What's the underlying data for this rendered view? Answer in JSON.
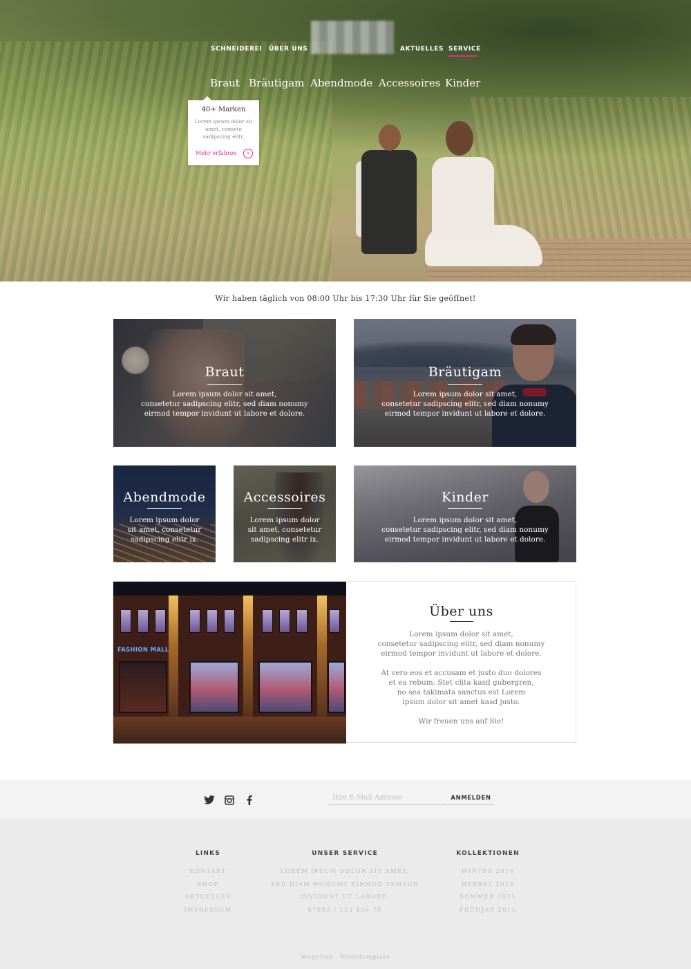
{
  "nav": {
    "items": [
      "SCHNEIDEREI",
      "ÜBER UNS",
      "AKTUELLES",
      "SERVICE"
    ],
    "active": "SERVICE",
    "accent_color": "#d9317f"
  },
  "subnav": {
    "items": [
      "Braut",
      "Bräutigam",
      "Abendmode",
      "Accessoires",
      "Kinder"
    ]
  },
  "dropdown": {
    "title": "40+ Marken",
    "text": "Lorem ipsum dolor sit amet, consete sadipscing elitr.",
    "link": "Mehr erfahren",
    "link_icon": "chevron-right-circle-icon"
  },
  "hours": "Wir haben täglich von 08:00 Uhr bis 17:30 Uhr für Sie geöffnet!",
  "tiles": [
    {
      "title": "Braut",
      "text": [
        "Lorem ipsum dolor sit amet,",
        "consetetur sadipscing elitr, sed diam nonumy",
        "eirmod tempor invidunt ut labore et dolore."
      ]
    },
    {
      "title": "Bräutigam",
      "text": [
        "Lorem ipsum dolor sit amet,",
        "consetetur sadipscing elitr, sed diam nonumy",
        "eirmod tempor invidunt ut labore et dolore."
      ]
    },
    {
      "title": "Abendmode",
      "text": [
        "Lorem ipsum dolor",
        "sit amet, consetetur",
        "sadipscing elitr ix."
      ]
    },
    {
      "title": "Accessoires",
      "text": [
        "Lorem ipsum dolor",
        "sit amet, consetetur",
        "sadipscing elitr ix."
      ]
    },
    {
      "title": "Kinder",
      "text": [
        "Lorem ipsum dolor sit amet,",
        "consetetur sadipscing elitr, sed diam nonumy",
        "eirmod tempor invidunt ut labore et dolore."
      ]
    }
  ],
  "about": {
    "photo_sign": "FASHION MALL",
    "title": "Über uns",
    "p1": [
      "Lorem ipsum dolor sit amet,",
      "consetetur sadipscing elitr, sed diam nonumy",
      "eirmod tempor invidunt ut labore et dolore."
    ],
    "p2": [
      "At vero eos et accusam et justo duo dolores",
      "et ea rebum. Stet clita kasd gubergren,",
      "no sea takimata sanctus est Lorem",
      "ipsum dolor sit amet kasd justo."
    ],
    "p3": "Wir freuen uns auf Sie!"
  },
  "newsletter": {
    "placeholder": "Ihre E-Mail Adresse",
    "button": "ANMELDEN"
  },
  "social": [
    "twitter-icon",
    "instagram-icon",
    "facebook-icon"
  ],
  "footer": {
    "columns": [
      {
        "heading": "LINKS",
        "items": [
          "KONTAKT",
          "SHOP",
          "AKTUELLES",
          "IMPRESSUM"
        ]
      },
      {
        "heading": "UNSER SERVICE",
        "items": [
          "LOREM IPSUM DOLOR SIT AMET,",
          "SED DIAM NONUMY EIRMOD TEMPOR",
          "INVIDUNT UT LABORE:",
          "07883 / 123 456 78"
        ]
      },
      {
        "heading": "KOLLEKTIONEN",
        "items": [
          "WINTER 2016",
          "HERBST 2015",
          "SOMMER 2015",
          "FRÜHJAR 2015"
        ]
      }
    ],
    "copyright": "Magellan - Modetemplate"
  }
}
